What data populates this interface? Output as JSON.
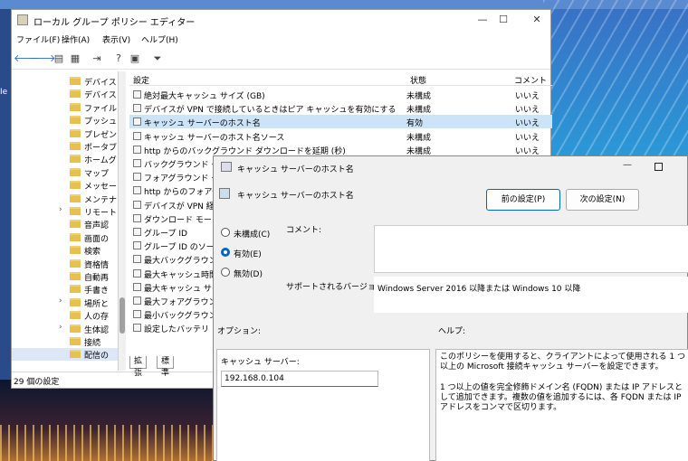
{
  "desktop": {
    "corner_text": "Ie"
  },
  "editor": {
    "title": "ローカル グループ ポリシー エディター",
    "menu": [
      "ファイル(F)",
      "操作(A)",
      "表示(V)",
      "ヘルプ(H)"
    ],
    "tree": [
      {
        "label": "デバイス",
        "chevron": false
      },
      {
        "label": "デバイス",
        "chevron": false
      },
      {
        "label": "ファイル",
        "chevron": false
      },
      {
        "label": "プッシュ",
        "chevron": false
      },
      {
        "label": "プレゼン",
        "chevron": false
      },
      {
        "label": "ポータブ",
        "chevron": false
      },
      {
        "label": "ホームグ",
        "chevron": false
      },
      {
        "label": "マップ",
        "chevron": false
      },
      {
        "label": "メッセー",
        "chevron": false
      },
      {
        "label": "メンテナ",
        "chevron": false
      },
      {
        "label": "リモート",
        "chevron": true
      },
      {
        "label": "音声認",
        "chevron": false
      },
      {
        "label": "画面の",
        "chevron": false
      },
      {
        "label": "検索",
        "chevron": false
      },
      {
        "label": "資格情",
        "chevron": false
      },
      {
        "label": "自動再",
        "chevron": false
      },
      {
        "label": "手書き",
        "chevron": false
      },
      {
        "label": "場所と",
        "chevron": true
      },
      {
        "label": "人の存",
        "chevron": false
      },
      {
        "label": "生体認",
        "chevron": true
      },
      {
        "label": "接続",
        "chevron": false
      },
      {
        "label": "配信の",
        "chevron": false
      }
    ],
    "columns": {
      "setting": "設定",
      "state": "状態",
      "comment": "コメント"
    },
    "rows": [
      {
        "name": "絶対最大キャッシュ サイズ (GB)",
        "state": "未構成",
        "comment": "いいえ"
      },
      {
        "name": "デバイスが VPN で接続しているときはピア キャッシュを有効にする",
        "state": "未構成",
        "comment": "いいえ"
      },
      {
        "name": "キャッシュ サーバーのホスト名",
        "state": "有効",
        "comment": "いいえ"
      },
      {
        "name": "キャッシュ サーバーのホスト名ソース",
        "state": "未構成",
        "comment": "いいえ"
      },
      {
        "name": "http からのバックグラウンド ダウンロードを延期 (秒)",
        "state": "未構成",
        "comment": "いいえ"
      },
      {
        "name": "バックグラウンド ダウ",
        "state": "未構成",
        "comment": "いいえ"
      },
      {
        "name": "フォアグラウンド ダウ",
        "state": "",
        "comment": ""
      },
      {
        "name": "http からのフォアグラ",
        "state": "",
        "comment": ""
      },
      {
        "name": "デバイスが VPN 経由",
        "state": "",
        "comment": ""
      },
      {
        "name": "ダウンロード モード",
        "state": "",
        "comment": ""
      },
      {
        "name": "グループ ID",
        "state": "",
        "comment": ""
      },
      {
        "name": "グループ ID のソースを",
        "state": "",
        "comment": ""
      },
      {
        "name": "最大バックグラウンド",
        "state": "",
        "comment": ""
      },
      {
        "name": "最大キャッシュ時間",
        "state": "",
        "comment": ""
      },
      {
        "name": "最大キャッシュ サイズ",
        "state": "",
        "comment": ""
      },
      {
        "name": "最大フォアグラウンド",
        "state": "",
        "comment": ""
      },
      {
        "name": "最小バックグラウンド",
        "state": "",
        "comment": ""
      },
      {
        "name": "設定したバッテリ レベ",
        "state": "",
        "comment": ""
      }
    ],
    "tabs": {
      "extended": "拡張",
      "standard": "標準"
    },
    "status": "29 個の設定"
  },
  "dialog": {
    "title": "キャッシュ サーバーのホスト名",
    "heading": "キャッシュ サーバーのホスト名",
    "prev_button": "前の設定(P)",
    "next_button": "次の設定(N)",
    "radios": {
      "not_configured": "未構成(C)",
      "enabled": "有効(E)",
      "disabled": "無効(D)"
    },
    "selected": "enabled",
    "comment_label": "コメント:",
    "supported_label": "サポートされるバージョン:",
    "supported_value": "Windows Server 2016 以降または Windows 10 以降",
    "options_label": "オプション:",
    "help_label": "ヘルプ:",
    "cache_server_label": "キャッシュ サーバー:",
    "cache_server_value": "192.168.0.104",
    "help_p1": "このポリシーを使用すると、クライアントによって使用される 1 つ以上の Microsoft 接続キャッシュ サーバーを設定できます。",
    "help_p2": "1 つ以上の値を完全修飾ドメイン名 (FQDN) または IP アドレスとして追加できます。複数の値を追加するには、各 FQDN または IP アドレスをコンマで区切ります。"
  }
}
